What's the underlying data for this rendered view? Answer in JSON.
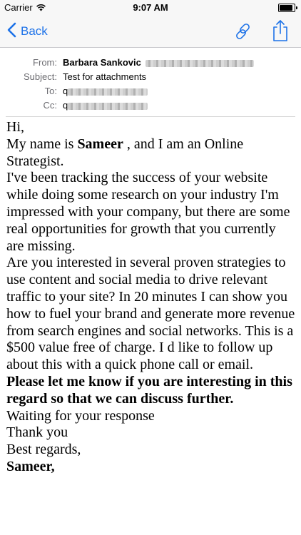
{
  "status_bar": {
    "carrier": "Carrier",
    "time": "9:07 AM",
    "battery_level": 1.0,
    "icons": [
      "wifi-icon",
      "battery-icon"
    ]
  },
  "nav": {
    "back_label": "Back",
    "icons": [
      "chevron-left-icon",
      "link-icon",
      "share-icon"
    ],
    "accent_color": "#1d72e8"
  },
  "header": {
    "from_label": "From:",
    "from_name": "Barbara Sankovic",
    "subject_label": "Subject:",
    "subject_value": "Test for attachments",
    "to_label": "To:",
    "to_prefix": "q",
    "cc_label": "Cc:",
    "cc_prefix": "q"
  },
  "body": {
    "greeting": "Hi,",
    "intro_pre": "My name is ",
    "intro_name": "Sameer",
    "intro_post": " , and I am an Online Strategist.",
    "para1": "I've been tracking the success of your website while doing some research on your industry I'm impressed with your company, but there are some real opportunities for growth that you currently are missing.",
    "para2": "Are you interested in several proven strategies to use content and social media to drive relevant traffic to your site? In 20 minutes I can show you how to fuel your brand and generate more revenue from search engines and social networks. This is a $500 value free of charge. I d like to follow up about this with a quick phone call or email.",
    "para3_bold": "Please let me know if you are interesting in this regard so that we can discuss further.",
    "line_waiting": "Waiting for your response",
    "line_thanks": "Thank you",
    "line_regards": "Best regards,",
    "signature": "Sameer,"
  }
}
